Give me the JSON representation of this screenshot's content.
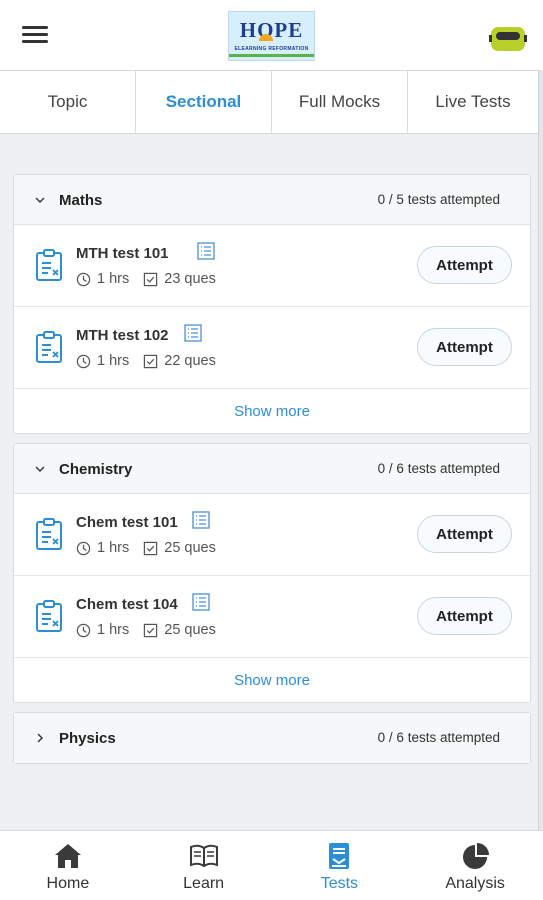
{
  "header": {
    "logo_text": "HOPE",
    "logo_tagline": "ELEARNING REFORMATION"
  },
  "tabs": [
    {
      "label": "Topic",
      "active": false
    },
    {
      "label": "Sectional",
      "active": true
    },
    {
      "label": "Full Mocks",
      "active": false
    },
    {
      "label": "Live Tests",
      "active": false
    }
  ],
  "sections": [
    {
      "title": "Maths",
      "count": "0 / 5 tests attempted",
      "expanded": true,
      "tests": [
        {
          "name": "MTH test 101",
          "duration": "1 hrs",
          "questions": "23 ques",
          "button": "Attempt"
        },
        {
          "name": "MTH test 102",
          "duration": "1 hrs",
          "questions": "22 ques",
          "button": "Attempt"
        }
      ],
      "show_more": "Show more"
    },
    {
      "title": "Chemistry",
      "count": "0 / 6 tests attempted",
      "expanded": true,
      "tests": [
        {
          "name": "Chem test 101",
          "duration": "1 hrs",
          "questions": "25 ques",
          "button": "Attempt"
        },
        {
          "name": "Chem test 104",
          "duration": "1 hrs",
          "questions": "25 ques",
          "button": "Attempt"
        }
      ],
      "show_more": "Show more"
    },
    {
      "title": "Physics",
      "count": "0 / 6 tests attempted",
      "expanded": false
    }
  ],
  "bottom_nav": [
    {
      "label": "Home",
      "icon": "home-icon",
      "active": false
    },
    {
      "label": "Learn",
      "icon": "book-icon",
      "active": false
    },
    {
      "label": "Tests",
      "icon": "tests-icon",
      "active": true
    },
    {
      "label": "Analysis",
      "icon": "pie-chart-icon",
      "active": false
    }
  ],
  "colors": {
    "accent": "#2c8fd6",
    "background": "#eef0f2",
    "avatar": "#b8cf2c"
  }
}
